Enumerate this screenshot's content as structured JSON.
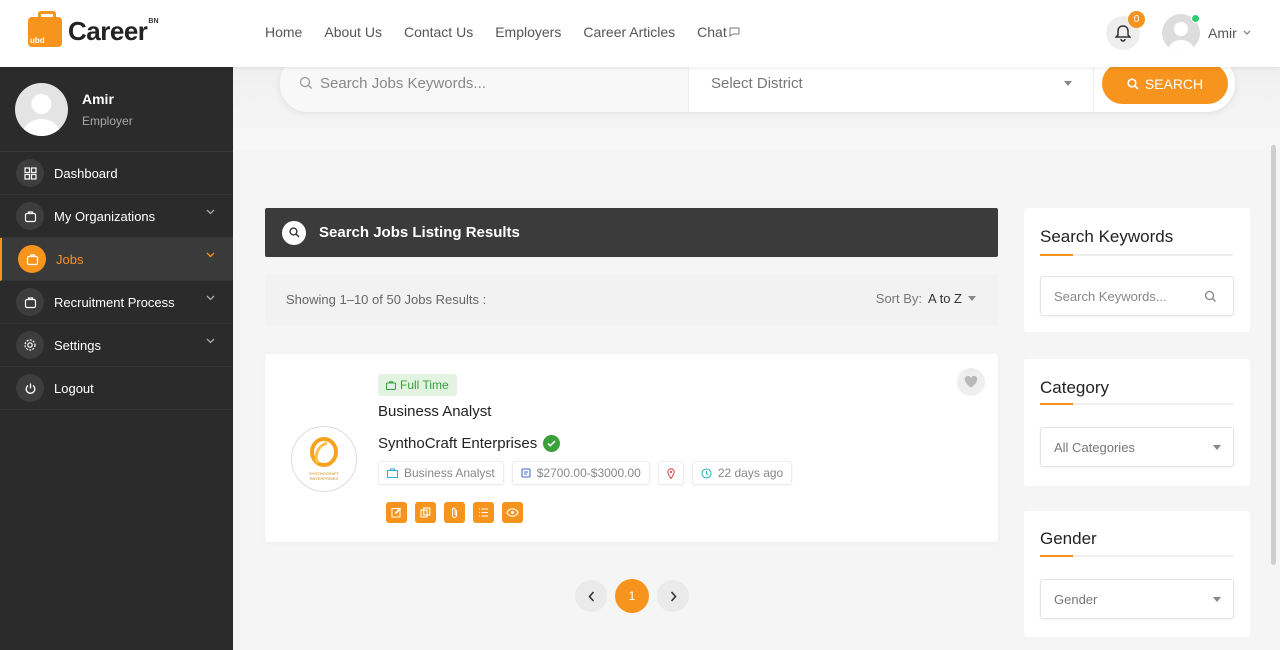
{
  "brand": {
    "name": "Career",
    "sup": "BN",
    "bag_label": "ubd"
  },
  "nav": [
    "Home",
    "About Us",
    "Contact Us",
    "Employers",
    "Career Articles",
    "Chat"
  ],
  "notifications": {
    "count": "0"
  },
  "user": {
    "name": "Amir",
    "role": "Employer"
  },
  "sidebar": {
    "items": [
      {
        "label": "Dashboard",
        "icon": "dashboard-icon"
      },
      {
        "label": "My Organizations",
        "icon": "briefcase-icon"
      },
      {
        "label": "Jobs",
        "icon": "briefcase-icon"
      },
      {
        "label": "Recruitment Process",
        "icon": "briefcase-icon"
      },
      {
        "label": "Settings",
        "icon": "gear-icon"
      },
      {
        "label": "Logout",
        "icon": "power-icon"
      }
    ]
  },
  "search": {
    "placeholder": "Search Jobs Keywords...",
    "district": "Select District",
    "button": "SEARCH"
  },
  "results": {
    "heading": "Search Jobs Listing Results",
    "count_text": "Showing 1–10 of 50 Jobs Results :",
    "sort_label": "Sort By:",
    "sort_value": "A to Z"
  },
  "jobs": [
    {
      "type": "Full Time",
      "title": "Business Analyst",
      "company": "SynthoCraft Enterprises",
      "logo_caption": "SYNTHOCRAFT ENTERPRISES",
      "category": "Business Analyst",
      "salary": "$2700.00-$3000.00",
      "posted": "22 days ago"
    }
  ],
  "pagination": {
    "current": "1"
  },
  "widgets": {
    "keywords": {
      "title": "Search Keywords",
      "placeholder": "Search Keywords..."
    },
    "category": {
      "title": "Category",
      "value": "All Categories"
    },
    "gender": {
      "title": "Gender",
      "value": "Gender"
    }
  },
  "colors": {
    "accent": "#f7941d",
    "sidebar": "#2b2b2b",
    "success": "#3aa03a"
  }
}
